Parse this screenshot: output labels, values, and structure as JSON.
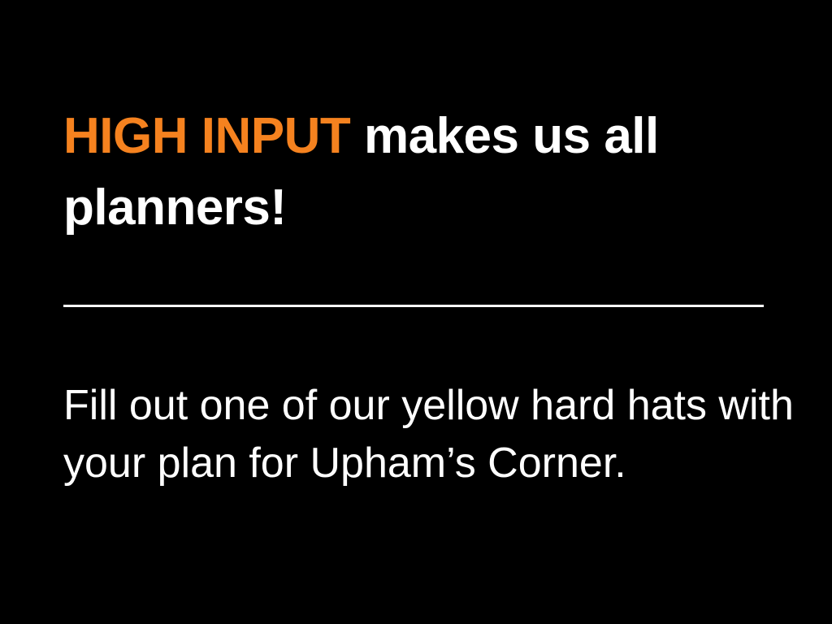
{
  "slide": {
    "headline_highlight": "HIGH INPUT",
    "headline_rest": " makes us all planners!",
    "body": "Fill out one of our yellow hard hats with your plan for Upham’s Corner."
  },
  "colors": {
    "background": "#000000",
    "accent": "#f5821f",
    "text": "#ffffff"
  }
}
